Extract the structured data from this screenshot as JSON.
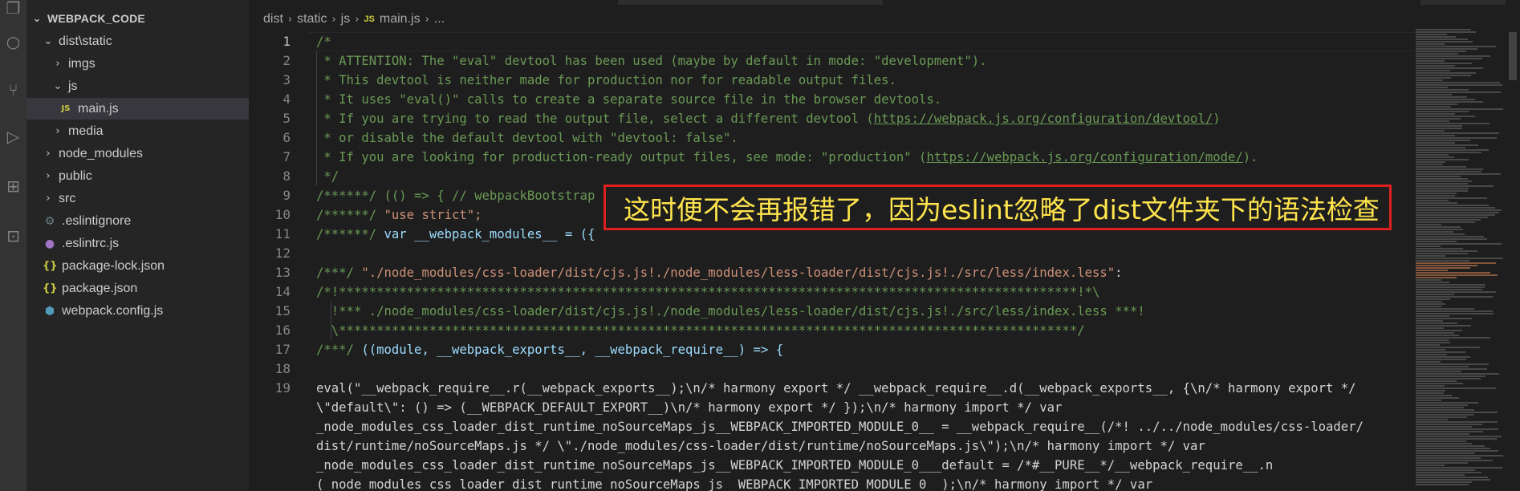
{
  "activity_bar": {
    "icons": [
      "files-icon",
      "search-icon",
      "source-control-icon",
      "run-debug-icon",
      "extensions-icon",
      "remote-explorer-icon"
    ]
  },
  "sidebar": {
    "root_label": "WEBPACK_CODE",
    "items": [
      {
        "label": "dist\\static",
        "kind": "folder",
        "expanded": true
      },
      {
        "label": "imgs",
        "kind": "folder",
        "expanded": false
      },
      {
        "label": "js",
        "kind": "folder",
        "expanded": true
      },
      {
        "label": "main.js",
        "kind": "file",
        "icon": "JS",
        "active": true
      },
      {
        "label": "media",
        "kind": "folder",
        "expanded": false
      },
      {
        "label": "node_modules",
        "kind": "folder",
        "expanded": false
      },
      {
        "label": "public",
        "kind": "folder",
        "expanded": false
      },
      {
        "label": "src",
        "kind": "folder",
        "expanded": false
      },
      {
        "label": ".eslintignore",
        "kind": "file"
      },
      {
        "label": ".eslintrc.js",
        "kind": "file"
      },
      {
        "label": "package-lock.json",
        "kind": "file",
        "icon": "{}"
      },
      {
        "label": "package.json",
        "kind": "file",
        "icon": "{}"
      },
      {
        "label": "webpack.config.js",
        "kind": "file"
      }
    ]
  },
  "breadcrumb": {
    "parts": [
      "dist",
      "static",
      "js"
    ],
    "file_icon": "JS",
    "file": "main.js",
    "tail": "..."
  },
  "editor": {
    "line_numbers": [
      "1",
      "2",
      "3",
      "4",
      "5",
      "6",
      "7",
      "8",
      "9",
      "10",
      "11",
      "12",
      "13",
      "14",
      "15",
      "16",
      "17",
      "18",
      "19"
    ],
    "current_line": "1",
    "code": {
      "l1": "/*",
      "l2": " * ATTENTION: The \"eval\" devtool has been used (maybe by default in mode: \"development\").",
      "l3": " * This devtool is neither made for production nor for readable output files.",
      "l4": " * It uses \"eval()\" calls to create a separate source file in the browser devtools.",
      "l5a": " * If you are trying to read the output file, select a different devtool (",
      "l5url": "https://webpack.js.org/configuration/devtool/",
      "l5b": ")",
      "l6": " * or disable the default devtool with \"devtool: false\".",
      "l7a": " * If you are looking for production-ready output files, see mode: \"production\" (",
      "l7url": "https://webpack.js.org/configuration/mode/",
      "l7b": ").",
      "l8": " */",
      "l9a": "/******/ ",
      "l9b": "(() => { // webpackBootstrap",
      "l10a": "/******/ ",
      "l10b": "\"use strict\";",
      "l11a": "/******/ ",
      "l11b": "var __webpack_modules__ = ({",
      "l13a": "/***/ ",
      "l13b": "\"./node_modules/css-loader/dist/cjs.js!./node_modules/less-loader/dist/cjs.js!./src/less/index.less\"",
      "l13c": ":",
      "l14": "/*!**************************************************************************************************!*\\",
      "l15": "  !*** ./node_modules/css-loader/dist/cjs.js!./node_modules/less-loader/dist/cjs.js!./src/less/index.less ***!",
      "l16": "  \\**************************************************************************************************/",
      "l17a": "/***/ ",
      "l17b": "((module, __webpack_exports__, __webpack_require__) => {",
      "l19_1": "eval(\"__webpack_require__.r(__webpack_exports__);\\n/* harmony export */ __webpack_require__.d(__webpack_exports__, {\\n/* harmony export */",
      "l19_2": "\\\"default\\\": () => (__WEBPACK_DEFAULT_EXPORT__)\\n/* harmony export */ });\\n/* harmony import */ var",
      "l19_3": "_node_modules_css_loader_dist_runtime_noSourceMaps_js__WEBPACK_IMPORTED_MODULE_0__ = __webpack_require__(/*! ../../node_modules/css-loader/",
      "l19_4": "dist/runtime/noSourceMaps.js */ \\\"./node_modules/css-loader/dist/runtime/noSourceMaps.js\\\");\\n/* harmony import */ var",
      "l19_5": "_node_modules_css_loader_dist_runtime_noSourceMaps_js__WEBPACK_IMPORTED_MODULE_0___default = /*#__PURE__*/__webpack_require__.n",
      "l19_6": "(_node_modules_css_loader_dist_runtime_noSourceMaps_js__WEBPACK_IMPORTED_MODULE_0__);\\n/* harmony import */ var"
    }
  },
  "callout": {
    "text": "这时便不会再报错了，因为eslint忽略了dist文件夹下的语法检查",
    "border_color": "#e02020",
    "text_color": "#ffe44d"
  }
}
